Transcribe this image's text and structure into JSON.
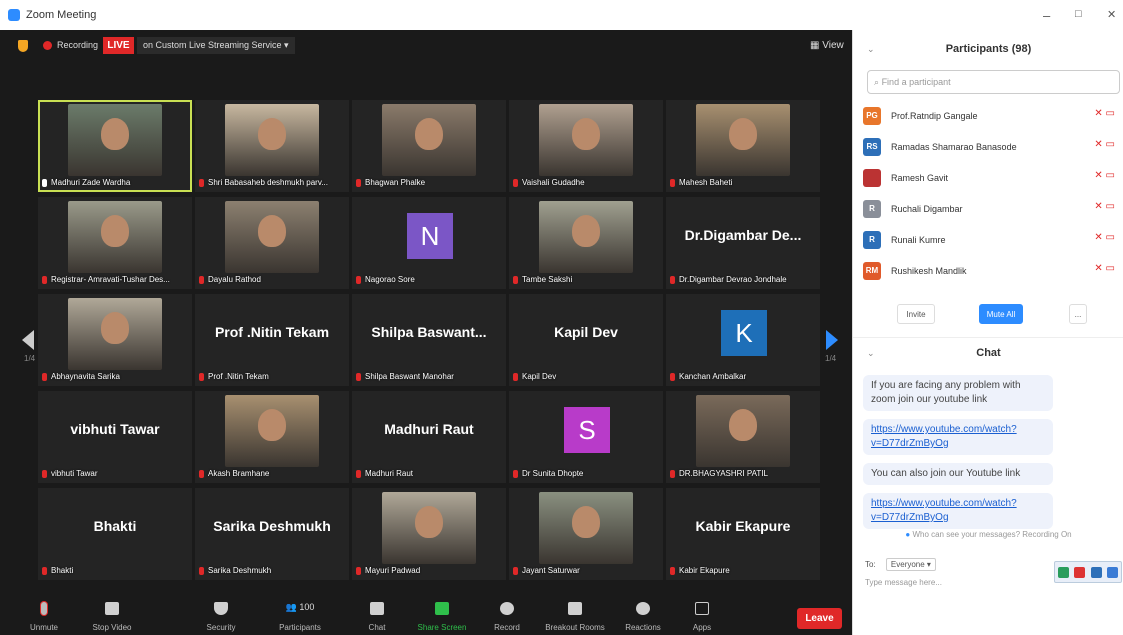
{
  "window": {
    "title": "Zoom Meeting",
    "minimize": "–",
    "maximize": "□",
    "close": "✕"
  },
  "topbar": {
    "recording": "Recording",
    "live": "LIVE",
    "stream": "on Custom Live Streaming Service  ▾",
    "view": "▦ View"
  },
  "pager": {
    "left": "1/4",
    "right": "1/4"
  },
  "tiles": [
    {
      "name": "Madhuri Zade Wardha",
      "type": "video",
      "speaker": true
    },
    {
      "name": "Shri Babasaheb deshmukh parv...",
      "type": "video"
    },
    {
      "name": "Bhagwan Phalke",
      "type": "video"
    },
    {
      "name": "Vaishali Gudadhe",
      "type": "video"
    },
    {
      "name": "Mahesh Baheti",
      "type": "video"
    },
    {
      "name": "Registrar- Amravati-Tushar Des...",
      "type": "video"
    },
    {
      "name": "Dayalu Rathod",
      "type": "video"
    },
    {
      "name": "Nagorao Sore",
      "type": "avatar",
      "letter": "N",
      "color": "#7b56c6"
    },
    {
      "name": "Tambe Sakshi",
      "type": "video"
    },
    {
      "name": "Dr.Digambar Devrao Jondhale",
      "type": "text",
      "big": "Dr.Digambar De..."
    },
    {
      "name": "Abhaynavita Sarika",
      "type": "video"
    },
    {
      "name": "Prof .Nitin Tekam",
      "type": "text",
      "big": "Prof .Nitin Tekam"
    },
    {
      "name": "Shilpa Baswant Manohar",
      "type": "text",
      "big": "Shilpa  Baswant..."
    },
    {
      "name": "Kapil Dev",
      "type": "text",
      "big": "Kapil Dev"
    },
    {
      "name": "Kanchan Ambalkar",
      "type": "avatar",
      "letter": "K",
      "color": "#1e6fb8"
    },
    {
      "name": "vibhuti Tawar",
      "type": "text",
      "big": "vibhuti Tawar"
    },
    {
      "name": "Akash Bramhane",
      "type": "video"
    },
    {
      "name": "Madhuri Raut",
      "type": "text",
      "big": "Madhuri Raut"
    },
    {
      "name": "Dr Sunita Dhopte",
      "type": "avatar",
      "letter": "S",
      "color": "#b83bc9"
    },
    {
      "name": "DR.BHAGYASHRI PATIL",
      "type": "video"
    },
    {
      "name": "Bhakti",
      "type": "text",
      "big": "Bhakti"
    },
    {
      "name": "Sarika Deshmukh",
      "type": "text",
      "big": "Sarika Deshmukh"
    },
    {
      "name": "Mayuri Padwad",
      "type": "video"
    },
    {
      "name": "Jayant Saturwar",
      "type": "video"
    },
    {
      "name": "Kabir Ekapure",
      "type": "text",
      "big": "Kabir Ekapure"
    }
  ],
  "toolbar": {
    "unmute": "Unmute",
    "stop_video": "Stop Video",
    "security": "Security",
    "participants": "Participants",
    "participants_count": "100",
    "chat": "Chat",
    "share_screen": "Share Screen",
    "record": "Record",
    "breakout": "Breakout Rooms",
    "reactions": "Reactions",
    "apps": "Apps",
    "leave": "Leave"
  },
  "participants_panel": {
    "title": "Participants (98)",
    "search_placeholder": "Find a participant",
    "items": [
      {
        "initials": "PG",
        "name": "Prof.Ratndip Gangale",
        "color": "#e8762b"
      },
      {
        "initials": "RS",
        "name": "Ramadas Shamarao Banasode",
        "color": "#2d6fb8"
      },
      {
        "initials": "",
        "name": "Ramesh Gavit",
        "color": "#b33"
      },
      {
        "initials": "R",
        "name": "Ruchali Digambar",
        "color": "#8a8f99"
      },
      {
        "initials": "R",
        "name": "Runali Kumre",
        "color": "#2d6fb8"
      },
      {
        "initials": "RM",
        "name": "Rushikesh Mandlik",
        "color": "#e05a2b"
      }
    ],
    "invite": "Invite",
    "mute_all": "Mute All",
    "more": "..."
  },
  "chat_panel": {
    "title": "Chat",
    "msg1": "If you are facing any problem with zoom join our youtube link",
    "link1": "https://www.youtube.com/watch?v=D77drZmByOg",
    "msg2": "You can also join our Youtube link",
    "link2": "https://www.youtube.com/watch?v=D77drZmByOg",
    "note": "Who can see your messages? Recording On",
    "to_label": "To:",
    "to_value": "Everyone ▾",
    "input_placeholder": "Type message here..."
  }
}
